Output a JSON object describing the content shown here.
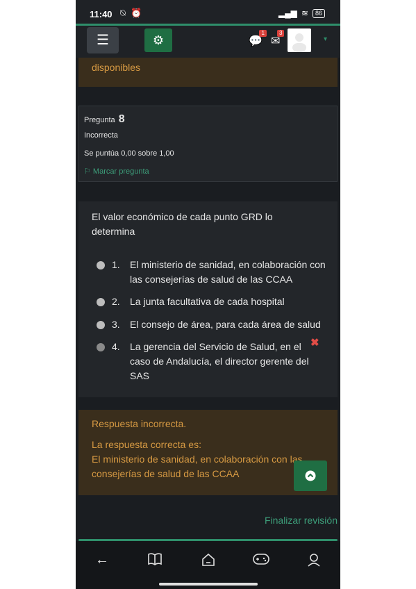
{
  "status": {
    "time": "11:40",
    "status_icons": "⍉ ⏰",
    "battery": "86"
  },
  "nav": {
    "menu_icon": "☰",
    "settings_icon": "⚙",
    "chat_icon": "💬",
    "chat_badge": "1",
    "mail_icon": "✉",
    "mail_badge": "3",
    "caret": "▾"
  },
  "alert_top": {
    "text": "disponibles"
  },
  "question_info": {
    "label": "Pregunta",
    "number": "8",
    "state": "Incorrecta",
    "grade": "Se puntúa 0,00 sobre 1,00",
    "flag": "Marcar pregunta"
  },
  "question": {
    "text": "El valor económico de cada punto GRD lo determina",
    "answers": [
      {
        "num": "1.",
        "text": "El ministerio de sanidad, en colaboración con las consejerías de salud de las CCAA"
      },
      {
        "num": "2.",
        "text": "La junta facultativa de cada hospital"
      },
      {
        "num": "3.",
        "text": "El consejo de área, para cada área de salud"
      },
      {
        "num": "4.",
        "text": "La gerencia del Servicio de Salud, en el caso de Andalucía, el director gerente del SAS"
      }
    ],
    "wrong_mark": "✖"
  },
  "feedback": {
    "result": "Respuesta incorrecta.",
    "correct_label": "La respuesta correcta es:",
    "correct_text": "El ministerio de sanidad, en colaboración con las consejerías de salud de las CCAA"
  },
  "scroll_top_icon": "⌃",
  "finalize_link": "Finalizar revisión",
  "bottom_nav": {
    "back": "←",
    "book": "📖",
    "home": "⌂",
    "game": "🎮",
    "profile": "👤"
  }
}
